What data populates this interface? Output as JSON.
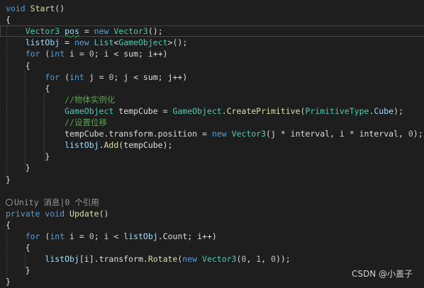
{
  "editor": {
    "lines": [
      {
        "tokens": [
          {
            "t": "void",
            "c": "kw"
          },
          {
            "t": " ",
            "c": "pl"
          },
          {
            "t": "Start",
            "c": "fn"
          },
          {
            "t": "()",
            "c": "pl"
          }
        ]
      },
      {
        "tokens": [
          {
            "t": "{",
            "c": "pl"
          }
        ]
      },
      {
        "tokens": [
          {
            "t": "    ",
            "c": "pl"
          },
          {
            "t": "Vector3",
            "c": "ty"
          },
          {
            "t": " ",
            "c": "pl"
          },
          {
            "t": "pos",
            "c": "var",
            "u": true
          },
          {
            "t": " = ",
            "c": "pl"
          },
          {
            "t": "new",
            "c": "kw"
          },
          {
            "t": " ",
            "c": "pl"
          },
          {
            "t": "Vector3",
            "c": "ty"
          },
          {
            "t": "();",
            "c": "pl"
          }
        ],
        "current": true
      },
      {
        "tokens": [
          {
            "t": "    ",
            "c": "pl"
          },
          {
            "t": "listObj",
            "c": "var"
          },
          {
            "t": " = ",
            "c": "pl"
          },
          {
            "t": "new",
            "c": "kw"
          },
          {
            "t": " ",
            "c": "pl"
          },
          {
            "t": "List",
            "c": "ty"
          },
          {
            "t": "<",
            "c": "pl"
          },
          {
            "t": "GameObject",
            "c": "ty"
          },
          {
            "t": ">();",
            "c": "pl"
          }
        ]
      },
      {
        "tokens": [
          {
            "t": "    ",
            "c": "pl"
          },
          {
            "t": "for",
            "c": "kw"
          },
          {
            "t": " (",
            "c": "pl"
          },
          {
            "t": "int",
            "c": "kw"
          },
          {
            "t": " i = ",
            "c": "pl"
          },
          {
            "t": "0",
            "c": "num"
          },
          {
            "t": "; i < sum; i++)",
            "c": "pl"
          }
        ]
      },
      {
        "tokens": [
          {
            "t": "    {",
            "c": "pl"
          }
        ]
      },
      {
        "tokens": [
          {
            "t": "        ",
            "c": "pl"
          },
          {
            "t": "for",
            "c": "kw"
          },
          {
            "t": " (",
            "c": "pl"
          },
          {
            "t": "int",
            "c": "kw"
          },
          {
            "t": " j = ",
            "c": "pl"
          },
          {
            "t": "0",
            "c": "num"
          },
          {
            "t": "; j < sum; j++)",
            "c": "pl"
          }
        ]
      },
      {
        "tokens": [
          {
            "t": "        {",
            "c": "pl"
          }
        ]
      },
      {
        "tokens": [
          {
            "t": "            ",
            "c": "pl"
          },
          {
            "t": "//物体实例化",
            "c": "cm"
          }
        ]
      },
      {
        "tokens": [
          {
            "t": "            ",
            "c": "pl"
          },
          {
            "t": "GameObject",
            "c": "ty"
          },
          {
            "t": " tempCube = ",
            "c": "pl"
          },
          {
            "t": "GameObject",
            "c": "ty"
          },
          {
            "t": ".",
            "c": "pl"
          },
          {
            "t": "CreatePrimitive",
            "c": "fn"
          },
          {
            "t": "(",
            "c": "pl"
          },
          {
            "t": "PrimitiveType",
            "c": "ty"
          },
          {
            "t": ".",
            "c": "pl"
          },
          {
            "t": "Cube",
            "c": "var"
          },
          {
            "t": ");",
            "c": "pl"
          }
        ]
      },
      {
        "tokens": [
          {
            "t": "            ",
            "c": "pl"
          },
          {
            "t": "//设置位移",
            "c": "cm"
          }
        ]
      },
      {
        "tokens": [
          {
            "t": "            ",
            "c": "pl"
          },
          {
            "t": "tempCube",
            "c": "pl"
          },
          {
            "t": ".",
            "c": "pl"
          },
          {
            "t": "transform",
            "c": "pl"
          },
          {
            "t": ".",
            "c": "pl"
          },
          {
            "t": "position",
            "c": "pl"
          },
          {
            "t": " = ",
            "c": "pl"
          },
          {
            "t": "new",
            "c": "kw"
          },
          {
            "t": " ",
            "c": "pl"
          },
          {
            "t": "Vector3",
            "c": "ty"
          },
          {
            "t": "(j * interval, i * interval, ",
            "c": "pl"
          },
          {
            "t": "0",
            "c": "num"
          },
          {
            "t": ");",
            "c": "pl"
          }
        ]
      },
      {
        "tokens": [
          {
            "t": "            ",
            "c": "pl"
          },
          {
            "t": "listObj",
            "c": "var"
          },
          {
            "t": ".",
            "c": "pl"
          },
          {
            "t": "Add",
            "c": "fn"
          },
          {
            "t": "(tempCube);",
            "c": "pl"
          }
        ]
      },
      {
        "tokens": [
          {
            "t": "        }",
            "c": "pl"
          }
        ]
      },
      {
        "tokens": [
          {
            "t": "    }",
            "c": "pl"
          }
        ]
      },
      {
        "tokens": [
          {
            "t": "}",
            "c": "pl"
          }
        ]
      },
      {
        "tokens": []
      },
      {
        "tokens": [
          {
            "t": "Unity 消息|0 个引用",
            "c": "meta"
          }
        ],
        "codelens": true
      },
      {
        "tokens": [
          {
            "t": "private",
            "c": "kw"
          },
          {
            "t": " ",
            "c": "pl"
          },
          {
            "t": "void",
            "c": "kw"
          },
          {
            "t": " ",
            "c": "pl"
          },
          {
            "t": "Update",
            "c": "fn"
          },
          {
            "t": "()",
            "c": "pl"
          }
        ]
      },
      {
        "tokens": [
          {
            "t": "{",
            "c": "pl"
          }
        ]
      },
      {
        "tokens": [
          {
            "t": "    ",
            "c": "pl"
          },
          {
            "t": "for",
            "c": "kw"
          },
          {
            "t": " (",
            "c": "pl"
          },
          {
            "t": "int",
            "c": "kw"
          },
          {
            "t": " i = ",
            "c": "pl"
          },
          {
            "t": "0",
            "c": "num"
          },
          {
            "t": "; i < ",
            "c": "pl"
          },
          {
            "t": "listObj",
            "c": "var"
          },
          {
            "t": ".",
            "c": "pl"
          },
          {
            "t": "Count",
            "c": "pl"
          },
          {
            "t": "; i++)",
            "c": "pl"
          }
        ]
      },
      {
        "tokens": [
          {
            "t": "    {",
            "c": "pl"
          }
        ]
      },
      {
        "tokens": [
          {
            "t": "        ",
            "c": "pl"
          },
          {
            "t": "listObj",
            "c": "var"
          },
          {
            "t": "[i].",
            "c": "pl"
          },
          {
            "t": "transform",
            "c": "pl"
          },
          {
            "t": ".",
            "c": "pl"
          },
          {
            "t": "Rotate",
            "c": "fn"
          },
          {
            "t": "(",
            "c": "pl"
          },
          {
            "t": "new",
            "c": "kw"
          },
          {
            "t": " ",
            "c": "pl"
          },
          {
            "t": "Vector3",
            "c": "ty"
          },
          {
            "t": "(",
            "c": "pl"
          },
          {
            "t": "0",
            "c": "num"
          },
          {
            "t": ", ",
            "c": "pl"
          },
          {
            "t": "1",
            "c": "num"
          },
          {
            "t": ", ",
            "c": "pl"
          },
          {
            "t": "0",
            "c": "num"
          },
          {
            "t": "));",
            "c": "pl"
          }
        ]
      },
      {
        "tokens": [
          {
            "t": "    }",
            "c": "pl"
          }
        ]
      },
      {
        "tokens": [
          {
            "t": "}",
            "c": "pl"
          }
        ]
      }
    ]
  },
  "watermark": "CSDN @小盖子"
}
